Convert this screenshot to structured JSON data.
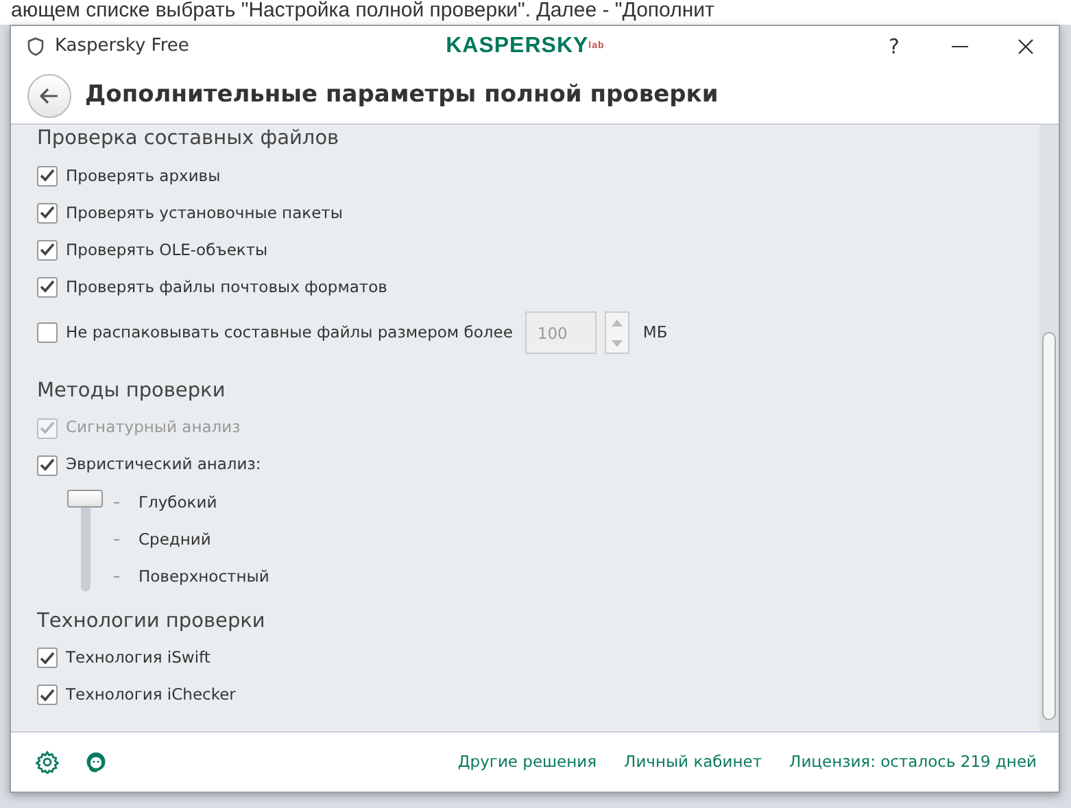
{
  "page_behind": {
    "text": "ающем списке выбрать \"Настройка полной проверки\". Далее - \"Дополнит"
  },
  "window": {
    "title": "Kaspersky Free",
    "logo": "KASPERSKY",
    "logo_mark": "lab",
    "help": "?"
  },
  "header": {
    "title": "Дополнительные параметры полной проверки"
  },
  "sections": [
    {
      "title": "Проверка составных файлов",
      "items": [
        {
          "kind": "checkbox",
          "label": "Проверять архивы",
          "checked": true,
          "disabled": false
        },
        {
          "kind": "checkbox",
          "label": "Проверять установочные пакеты",
          "checked": true,
          "disabled": false
        },
        {
          "kind": "checkbox",
          "label": "Проверять OLE-объекты",
          "checked": true,
          "disabled": false
        },
        {
          "kind": "checkbox",
          "label": "Проверять файлы почтовых форматов",
          "checked": true,
          "disabled": false
        },
        {
          "kind": "spin",
          "label": "Не распаковывать составные файлы размером более",
          "checked": false,
          "disabled": false,
          "value": "100",
          "unit": "МБ"
        }
      ]
    },
    {
      "title": "Методы проверки",
      "items": [
        {
          "kind": "checkbox",
          "label": "Сигнатурный анализ",
          "checked": true,
          "disabled": true
        },
        {
          "kind": "checkbox",
          "label": "Эвристический анализ:",
          "checked": true,
          "disabled": false
        },
        {
          "kind": "levels",
          "levels": [
            {
              "label": "Глубокий",
              "selected": true
            },
            {
              "label": "Средний",
              "selected": false
            },
            {
              "label": "Поверхностный",
              "selected": false
            }
          ]
        }
      ]
    },
    {
      "title": "Технологии проверки",
      "items": [
        {
          "kind": "checkbox",
          "label": "Технология iSwift",
          "checked": true,
          "disabled": false
        },
        {
          "kind": "checkbox",
          "label": "Технология iChecker",
          "checked": true,
          "disabled": false
        }
      ]
    }
  ],
  "footer": {
    "links": [
      "Другие решения",
      "Личный кабинет",
      "Лицензия: осталось 219 дней"
    ]
  }
}
